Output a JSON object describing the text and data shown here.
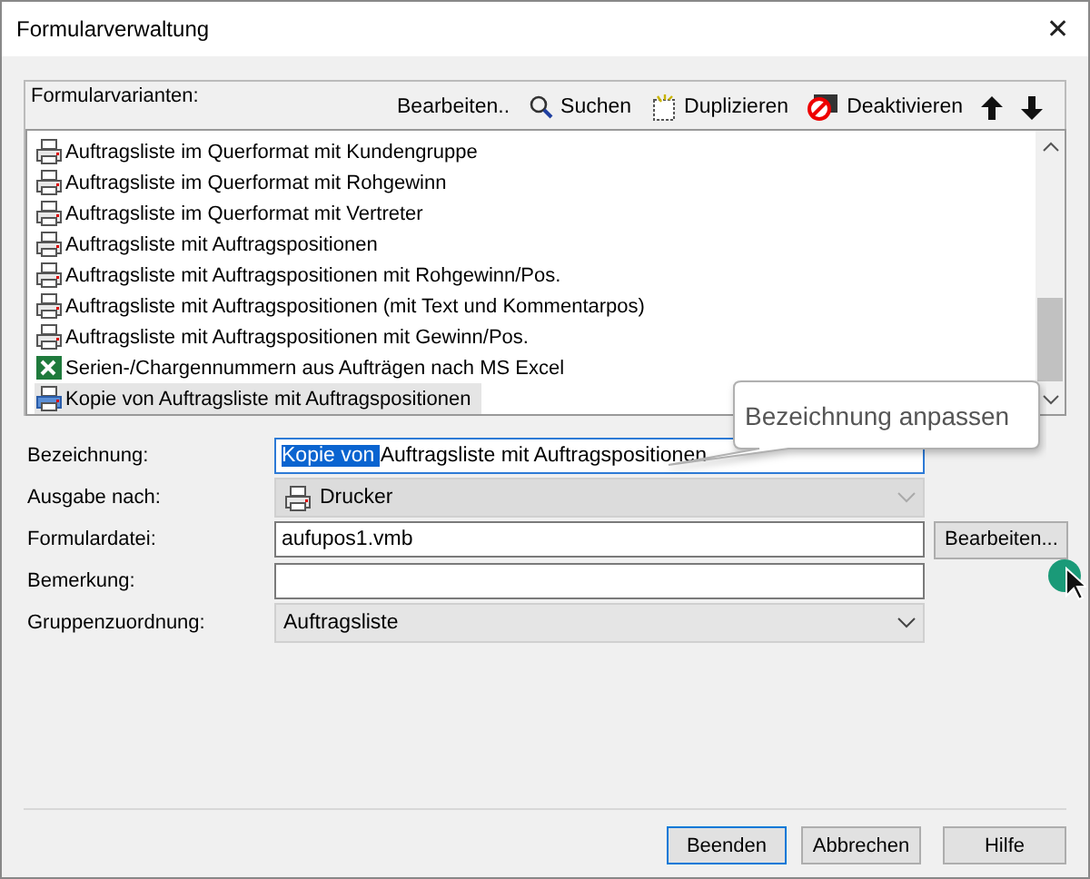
{
  "window": {
    "title": "Formularverwaltung",
    "close": "✕"
  },
  "variants": {
    "label": "Formularvarianten:",
    "toolbar": [
      {
        "kind": "edit",
        "label": "Bearbeiten.."
      },
      {
        "kind": "search",
        "label": "Suchen"
      },
      {
        "kind": "duplicate",
        "label": "Duplizieren"
      },
      {
        "kind": "deactivate",
        "label": "Deaktivieren"
      },
      {
        "kind": "up"
      },
      {
        "kind": "down"
      }
    ],
    "items": [
      {
        "kind": "printer",
        "label": "Auftragsliste im Querformat mit Kundengruppe",
        "selected": false
      },
      {
        "kind": "printer",
        "label": "Auftragsliste im Querformat mit Rohgewinn",
        "selected": false
      },
      {
        "kind": "printer",
        "label": "Auftragsliste im Querformat mit Vertreter",
        "selected": false
      },
      {
        "kind": "printer",
        "label": "Auftragsliste mit Auftragspositionen",
        "selected": false
      },
      {
        "kind": "printer",
        "label": "Auftragsliste mit Auftragspositionen mit Rohgewinn/Pos.",
        "selected": false
      },
      {
        "kind": "printer",
        "label": "Auftragsliste mit Auftragspositionen (mit Text und Kommentarpos)",
        "selected": false
      },
      {
        "kind": "printer",
        "label": "Auftragsliste mit Auftragspositionen mit Gewinn/Pos.",
        "selected": false
      },
      {
        "kind": "excel",
        "label": "Serien-/Chargennummern aus Aufträgen nach MS Excel",
        "selected": false
      },
      {
        "kind": "printer",
        "label": "Kopie von Auftragsliste mit Auftragspositionen",
        "selected": true
      }
    ]
  },
  "fields": [
    {
      "kind": "text",
      "label": "Bezeichnung:",
      "selected_text": "Kopie von ",
      "value": "Auftragsliste mit Auftragspositionen",
      "focused": true
    },
    {
      "kind": "printer-select",
      "label": "Ausgabe nach:",
      "value": "Drucker",
      "disabled": true
    },
    {
      "kind": "text",
      "label": "Formulardatei:",
      "value": "aufupos1.vmb",
      "focused": false,
      "button": "Bearbeiten..."
    },
    {
      "kind": "text",
      "label": "Bemerkung:",
      "focused": false
    },
    {
      "kind": "select",
      "label": "Gruppenzuordnung:",
      "value": "Auftragsliste",
      "disabled": false
    }
  ],
  "callout": {
    "text": "Bezeichnung anpassen"
  },
  "buttons": [
    {
      "label": "Beenden",
      "default": true
    },
    {
      "label": "Abbrechen",
      "default": false
    },
    {
      "label": "Hilfe",
      "default": false
    }
  ]
}
